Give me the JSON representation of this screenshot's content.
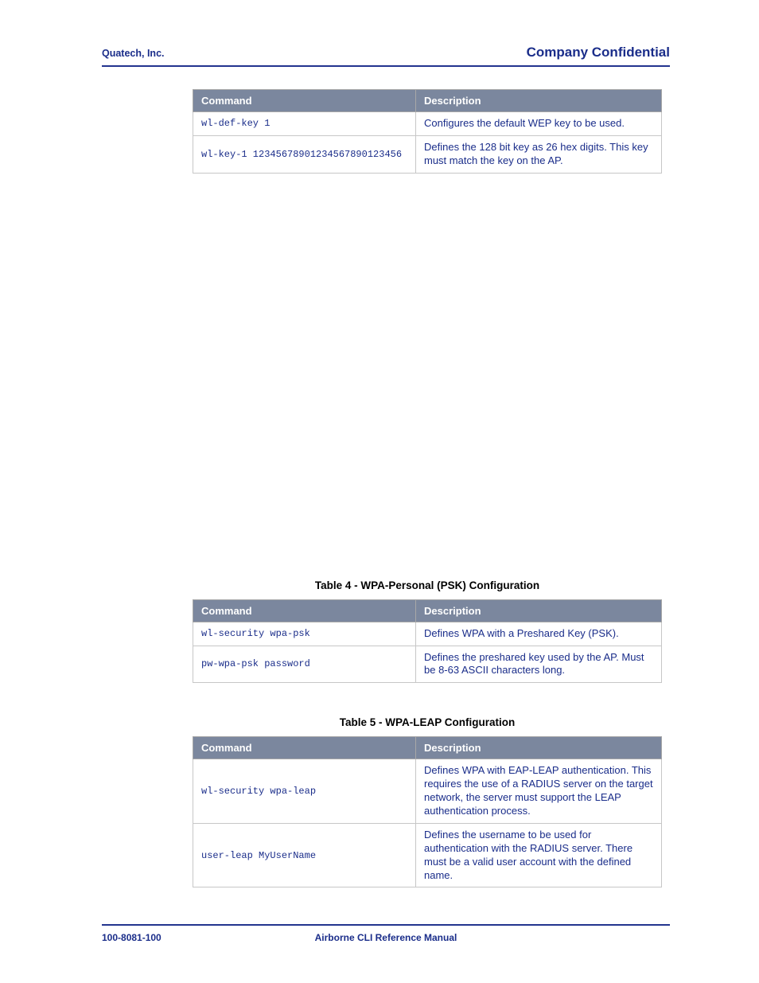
{
  "header": {
    "left": "Quatech, Inc.",
    "right": "Company Confidential"
  },
  "tables": {
    "t1": {
      "h1": "Command",
      "h2": "Description",
      "rows": [
        {
          "cmd": "wl-def-key 1",
          "desc": "Configures the default WEP key to be used."
        },
        {
          "cmd": "wl-key-1 12345678901234567890123456",
          "desc": "Defines the 128 bit key as 26 hex digits. This key must match the key on the AP."
        }
      ]
    },
    "t2": {
      "title": "Table 4 - WPA-Personal (PSK) Configuration",
      "h1": "Command",
      "h2": "Description",
      "rows": [
        {
          "cmd": "wl-security wpa-psk",
          "desc": "Defines WPA with a Preshared Key (PSK)."
        },
        {
          "cmd": "pw-wpa-psk password",
          "desc": "Defines the preshared key used by the AP. Must be 8-63 ASCII characters long."
        }
      ]
    },
    "t3": {
      "title": "Table 5 - WPA-LEAP Configuration",
      "h1": "Command",
      "h2": "Description",
      "rows": [
        {
          "cmd": "wl-security wpa-leap",
          "desc": "Defines WPA with EAP-LEAP authentication. This requires the use of a RADIUS server on the target network, the server must support the LEAP authentication process."
        },
        {
          "cmd": "user-leap MyUserName",
          "desc": "Defines the username to be used for authentication with the RADIUS server. There must be a valid user account with the defined name."
        }
      ]
    }
  },
  "footer": {
    "left": "100-8081-100",
    "center": "Airborne CLI Reference Manual"
  }
}
